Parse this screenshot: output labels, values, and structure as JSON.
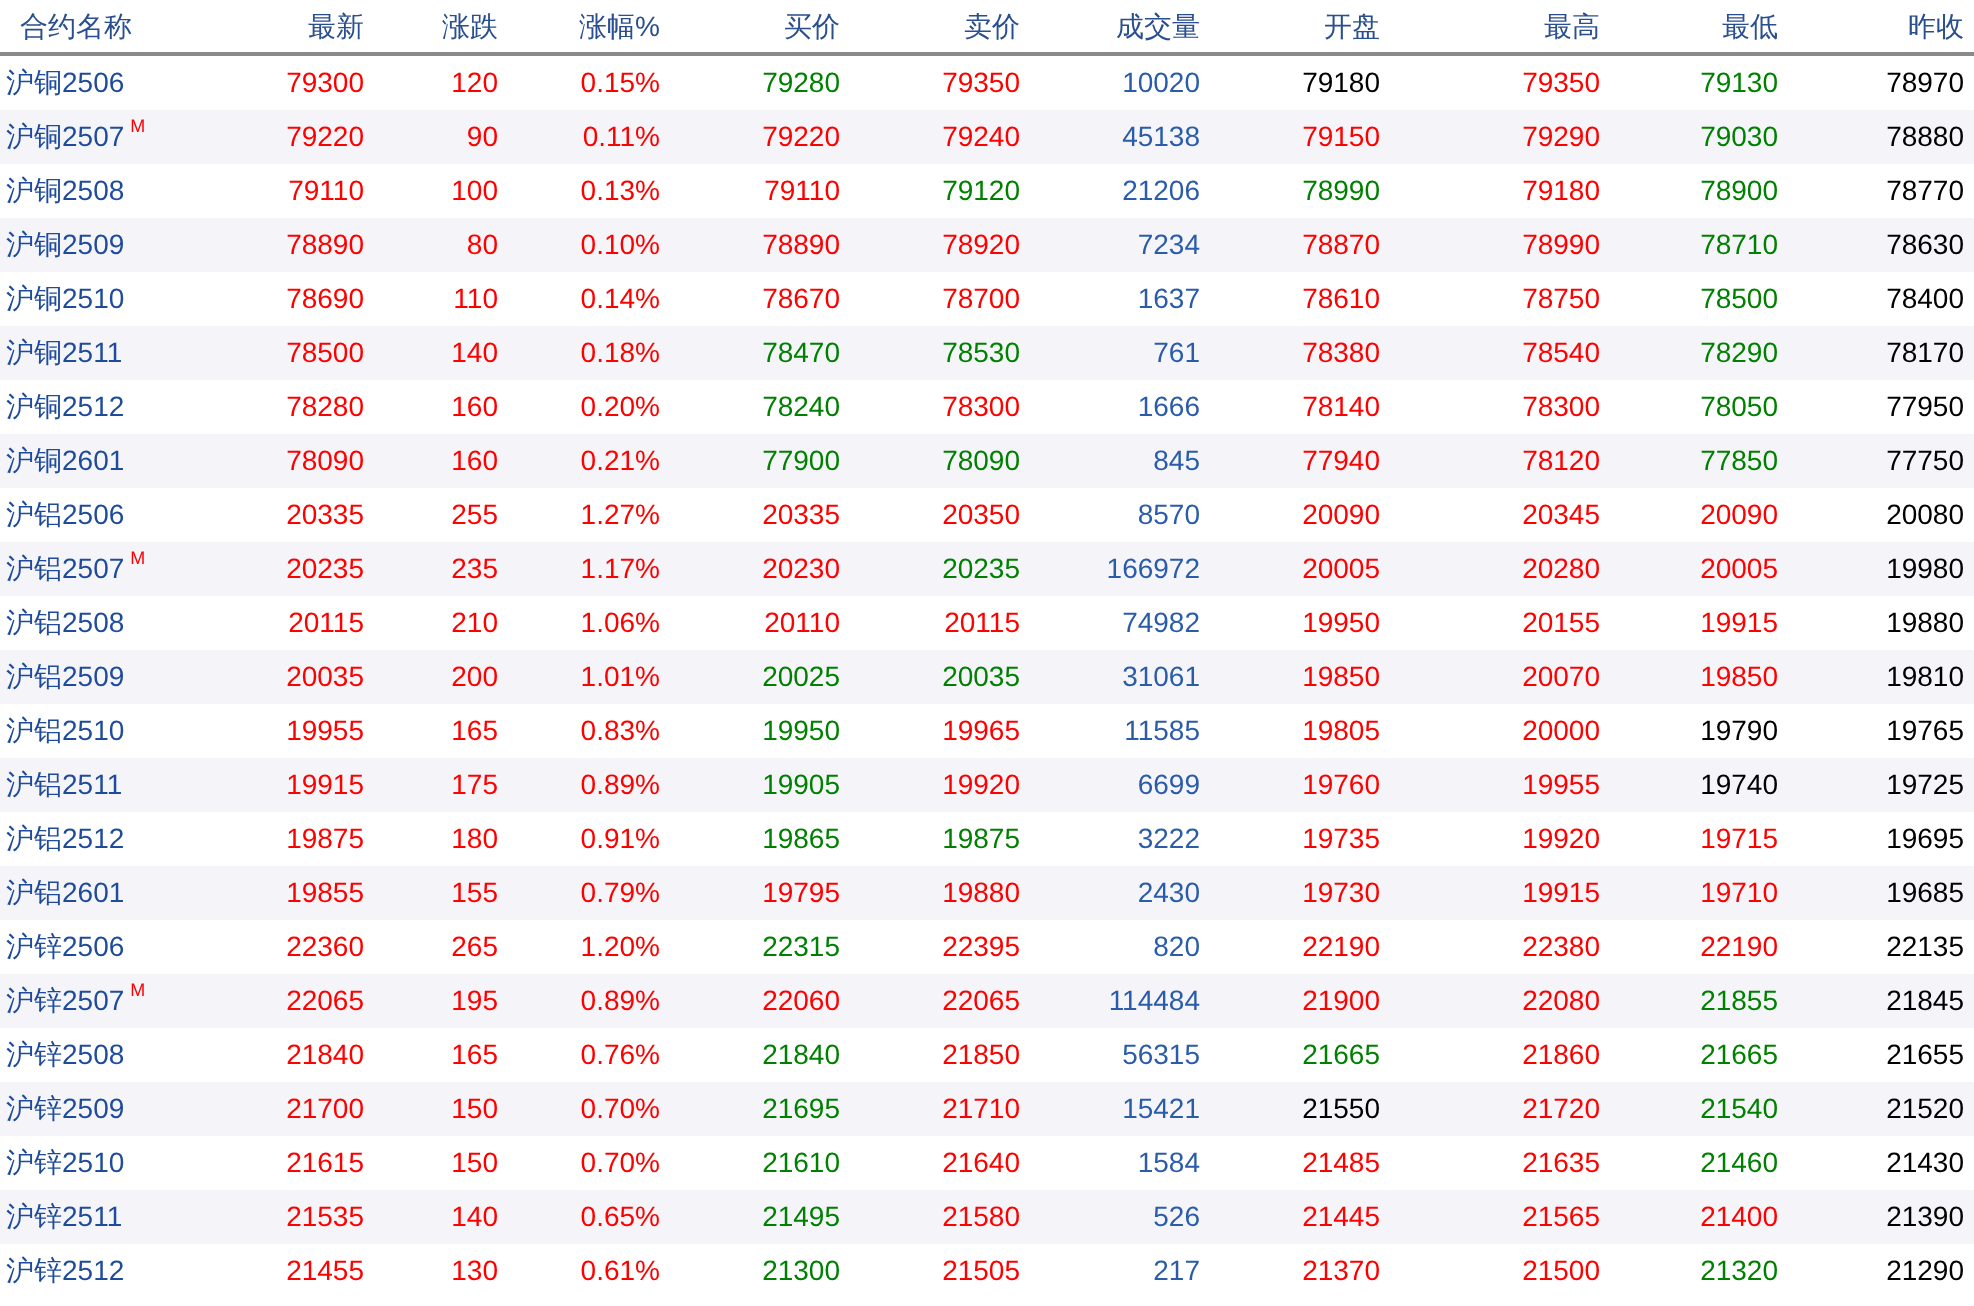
{
  "table": {
    "columns": [
      "合约名称",
      "最新",
      "涨跌",
      "涨幅%",
      "买价",
      "卖价",
      "成交量",
      "开盘",
      "最高",
      "最低",
      "昨收"
    ],
    "rows": [
      {
        "cells": [
          {
            "text": "沪铜2506",
            "color": "#1e4b9b"
          },
          {
            "text": "79300",
            "color": "#ff0000"
          },
          {
            "text": "120",
            "color": "#ff0000"
          },
          {
            "text": "0.15%",
            "color": "#ff0000"
          },
          {
            "text": "79280",
            "color": "#008000"
          },
          {
            "text": "79350",
            "color": "#ff0000"
          },
          {
            "text": "10020",
            "color": "#2a5caa"
          },
          {
            "text": "79180",
            "color": "#000000"
          },
          {
            "text": "79350",
            "color": "#ff0000"
          },
          {
            "text": "79130",
            "color": "#008000"
          },
          {
            "text": "78970",
            "color": "#000000"
          }
        ]
      },
      {
        "cells": [
          {
            "text": "沪铜2507",
            "color": "#1e4b9b",
            "badge": "M"
          },
          {
            "text": "79220",
            "color": "#ff0000"
          },
          {
            "text": "90",
            "color": "#ff0000"
          },
          {
            "text": "0.11%",
            "color": "#ff0000"
          },
          {
            "text": "79220",
            "color": "#ff0000"
          },
          {
            "text": "79240",
            "color": "#ff0000"
          },
          {
            "text": "45138",
            "color": "#2a5caa"
          },
          {
            "text": "79150",
            "color": "#ff0000"
          },
          {
            "text": "79290",
            "color": "#ff0000"
          },
          {
            "text": "79030",
            "color": "#008000"
          },
          {
            "text": "78880",
            "color": "#000000"
          }
        ]
      },
      {
        "cells": [
          {
            "text": "沪铜2508",
            "color": "#1e4b9b"
          },
          {
            "text": "79110",
            "color": "#ff0000"
          },
          {
            "text": "100",
            "color": "#ff0000"
          },
          {
            "text": "0.13%",
            "color": "#ff0000"
          },
          {
            "text": "79110",
            "color": "#ff0000"
          },
          {
            "text": "79120",
            "color": "#008000"
          },
          {
            "text": "21206",
            "color": "#2a5caa"
          },
          {
            "text": "78990",
            "color": "#008000"
          },
          {
            "text": "79180",
            "color": "#ff0000"
          },
          {
            "text": "78900",
            "color": "#008000"
          },
          {
            "text": "78770",
            "color": "#000000"
          }
        ]
      },
      {
        "cells": [
          {
            "text": "沪铜2509",
            "color": "#1e4b9b"
          },
          {
            "text": "78890",
            "color": "#ff0000"
          },
          {
            "text": "80",
            "color": "#ff0000"
          },
          {
            "text": "0.10%",
            "color": "#ff0000"
          },
          {
            "text": "78890",
            "color": "#ff0000"
          },
          {
            "text": "78920",
            "color": "#ff0000"
          },
          {
            "text": "7234",
            "color": "#2a5caa"
          },
          {
            "text": "78870",
            "color": "#ff0000"
          },
          {
            "text": "78990",
            "color": "#ff0000"
          },
          {
            "text": "78710",
            "color": "#008000"
          },
          {
            "text": "78630",
            "color": "#000000"
          }
        ]
      },
      {
        "cells": [
          {
            "text": "沪铜2510",
            "color": "#1e4b9b"
          },
          {
            "text": "78690",
            "color": "#ff0000"
          },
          {
            "text": "110",
            "color": "#ff0000"
          },
          {
            "text": "0.14%",
            "color": "#ff0000"
          },
          {
            "text": "78670",
            "color": "#ff0000"
          },
          {
            "text": "78700",
            "color": "#ff0000"
          },
          {
            "text": "1637",
            "color": "#2a5caa"
          },
          {
            "text": "78610",
            "color": "#ff0000"
          },
          {
            "text": "78750",
            "color": "#ff0000"
          },
          {
            "text": "78500",
            "color": "#008000"
          },
          {
            "text": "78400",
            "color": "#000000"
          }
        ]
      },
      {
        "cells": [
          {
            "text": "沪铜2511",
            "color": "#1e4b9b"
          },
          {
            "text": "78500",
            "color": "#ff0000"
          },
          {
            "text": "140",
            "color": "#ff0000"
          },
          {
            "text": "0.18%",
            "color": "#ff0000"
          },
          {
            "text": "78470",
            "color": "#008000"
          },
          {
            "text": "78530",
            "color": "#008000"
          },
          {
            "text": "761",
            "color": "#2a5caa"
          },
          {
            "text": "78380",
            "color": "#ff0000"
          },
          {
            "text": "78540",
            "color": "#ff0000"
          },
          {
            "text": "78290",
            "color": "#008000"
          },
          {
            "text": "78170",
            "color": "#000000"
          }
        ]
      },
      {
        "cells": [
          {
            "text": "沪铜2512",
            "color": "#1e4b9b"
          },
          {
            "text": "78280",
            "color": "#ff0000"
          },
          {
            "text": "160",
            "color": "#ff0000"
          },
          {
            "text": "0.20%",
            "color": "#ff0000"
          },
          {
            "text": "78240",
            "color": "#008000"
          },
          {
            "text": "78300",
            "color": "#ff0000"
          },
          {
            "text": "1666",
            "color": "#2a5caa"
          },
          {
            "text": "78140",
            "color": "#ff0000"
          },
          {
            "text": "78300",
            "color": "#ff0000"
          },
          {
            "text": "78050",
            "color": "#008000"
          },
          {
            "text": "77950",
            "color": "#000000"
          }
        ]
      },
      {
        "cells": [
          {
            "text": "沪铜2601",
            "color": "#1e4b9b"
          },
          {
            "text": "78090",
            "color": "#ff0000"
          },
          {
            "text": "160",
            "color": "#ff0000"
          },
          {
            "text": "0.21%",
            "color": "#ff0000"
          },
          {
            "text": "77900",
            "color": "#008000"
          },
          {
            "text": "78090",
            "color": "#008000"
          },
          {
            "text": "845",
            "color": "#2a5caa"
          },
          {
            "text": "77940",
            "color": "#ff0000"
          },
          {
            "text": "78120",
            "color": "#ff0000"
          },
          {
            "text": "77850",
            "color": "#008000"
          },
          {
            "text": "77750",
            "color": "#000000"
          }
        ]
      },
      {
        "cells": [
          {
            "text": "沪铝2506",
            "color": "#1e4b9b"
          },
          {
            "text": "20335",
            "color": "#ff0000"
          },
          {
            "text": "255",
            "color": "#ff0000"
          },
          {
            "text": "1.27%",
            "color": "#ff0000"
          },
          {
            "text": "20335",
            "color": "#ff0000"
          },
          {
            "text": "20350",
            "color": "#ff0000"
          },
          {
            "text": "8570",
            "color": "#2a5caa"
          },
          {
            "text": "20090",
            "color": "#ff0000"
          },
          {
            "text": "20345",
            "color": "#ff0000"
          },
          {
            "text": "20090",
            "color": "#ff0000"
          },
          {
            "text": "20080",
            "color": "#000000"
          }
        ]
      },
      {
        "cells": [
          {
            "text": "沪铝2507",
            "color": "#1e4b9b",
            "badge": "M"
          },
          {
            "text": "20235",
            "color": "#ff0000"
          },
          {
            "text": "235",
            "color": "#ff0000"
          },
          {
            "text": "1.17%",
            "color": "#ff0000"
          },
          {
            "text": "20230",
            "color": "#ff0000"
          },
          {
            "text": "20235",
            "color": "#008000"
          },
          {
            "text": "166972",
            "color": "#2a5caa"
          },
          {
            "text": "20005",
            "color": "#ff0000"
          },
          {
            "text": "20280",
            "color": "#ff0000"
          },
          {
            "text": "20005",
            "color": "#ff0000"
          },
          {
            "text": "19980",
            "color": "#000000"
          }
        ]
      },
      {
        "cells": [
          {
            "text": "沪铝2508",
            "color": "#1e4b9b"
          },
          {
            "text": "20115",
            "color": "#ff0000"
          },
          {
            "text": "210",
            "color": "#ff0000"
          },
          {
            "text": "1.06%",
            "color": "#ff0000"
          },
          {
            "text": "20110",
            "color": "#ff0000"
          },
          {
            "text": "20115",
            "color": "#ff0000"
          },
          {
            "text": "74982",
            "color": "#2a5caa"
          },
          {
            "text": "19950",
            "color": "#ff0000"
          },
          {
            "text": "20155",
            "color": "#ff0000"
          },
          {
            "text": "19915",
            "color": "#ff0000"
          },
          {
            "text": "19880",
            "color": "#000000"
          }
        ]
      },
      {
        "cells": [
          {
            "text": "沪铝2509",
            "color": "#1e4b9b"
          },
          {
            "text": "20035",
            "color": "#ff0000"
          },
          {
            "text": "200",
            "color": "#ff0000"
          },
          {
            "text": "1.01%",
            "color": "#ff0000"
          },
          {
            "text": "20025",
            "color": "#008000"
          },
          {
            "text": "20035",
            "color": "#008000"
          },
          {
            "text": "31061",
            "color": "#2a5caa"
          },
          {
            "text": "19850",
            "color": "#ff0000"
          },
          {
            "text": "20070",
            "color": "#ff0000"
          },
          {
            "text": "19850",
            "color": "#ff0000"
          },
          {
            "text": "19810",
            "color": "#000000"
          }
        ]
      },
      {
        "cells": [
          {
            "text": "沪铝2510",
            "color": "#1e4b9b"
          },
          {
            "text": "19955",
            "color": "#ff0000"
          },
          {
            "text": "165",
            "color": "#ff0000"
          },
          {
            "text": "0.83%",
            "color": "#ff0000"
          },
          {
            "text": "19950",
            "color": "#008000"
          },
          {
            "text": "19965",
            "color": "#ff0000"
          },
          {
            "text": "11585",
            "color": "#2a5caa"
          },
          {
            "text": "19805",
            "color": "#ff0000"
          },
          {
            "text": "20000",
            "color": "#ff0000"
          },
          {
            "text": "19790",
            "color": "#000000"
          },
          {
            "text": "19765",
            "color": "#000000"
          }
        ]
      },
      {
        "cells": [
          {
            "text": "沪铝2511",
            "color": "#1e4b9b"
          },
          {
            "text": "19915",
            "color": "#ff0000"
          },
          {
            "text": "175",
            "color": "#ff0000"
          },
          {
            "text": "0.89%",
            "color": "#ff0000"
          },
          {
            "text": "19905",
            "color": "#008000"
          },
          {
            "text": "19920",
            "color": "#ff0000"
          },
          {
            "text": "6699",
            "color": "#2a5caa"
          },
          {
            "text": "19760",
            "color": "#ff0000"
          },
          {
            "text": "19955",
            "color": "#ff0000"
          },
          {
            "text": "19740",
            "color": "#000000"
          },
          {
            "text": "19725",
            "color": "#000000"
          }
        ]
      },
      {
        "cells": [
          {
            "text": "沪铝2512",
            "color": "#1e4b9b"
          },
          {
            "text": "19875",
            "color": "#ff0000"
          },
          {
            "text": "180",
            "color": "#ff0000"
          },
          {
            "text": "0.91%",
            "color": "#ff0000"
          },
          {
            "text": "19865",
            "color": "#008000"
          },
          {
            "text": "19875",
            "color": "#008000"
          },
          {
            "text": "3222",
            "color": "#2a5caa"
          },
          {
            "text": "19735",
            "color": "#ff0000"
          },
          {
            "text": "19920",
            "color": "#ff0000"
          },
          {
            "text": "19715",
            "color": "#ff0000"
          },
          {
            "text": "19695",
            "color": "#000000"
          }
        ]
      },
      {
        "cells": [
          {
            "text": "沪铝2601",
            "color": "#1e4b9b"
          },
          {
            "text": "19855",
            "color": "#ff0000"
          },
          {
            "text": "155",
            "color": "#ff0000"
          },
          {
            "text": "0.79%",
            "color": "#ff0000"
          },
          {
            "text": "19795",
            "color": "#ff0000"
          },
          {
            "text": "19880",
            "color": "#ff0000"
          },
          {
            "text": "2430",
            "color": "#2a5caa"
          },
          {
            "text": "19730",
            "color": "#ff0000"
          },
          {
            "text": "19915",
            "color": "#ff0000"
          },
          {
            "text": "19710",
            "color": "#ff0000"
          },
          {
            "text": "19685",
            "color": "#000000"
          }
        ]
      },
      {
        "cells": [
          {
            "text": "沪锌2506",
            "color": "#1e4b9b"
          },
          {
            "text": "22360",
            "color": "#ff0000"
          },
          {
            "text": "265",
            "color": "#ff0000"
          },
          {
            "text": "1.20%",
            "color": "#ff0000"
          },
          {
            "text": "22315",
            "color": "#008000"
          },
          {
            "text": "22395",
            "color": "#ff0000"
          },
          {
            "text": "820",
            "color": "#2a5caa"
          },
          {
            "text": "22190",
            "color": "#ff0000"
          },
          {
            "text": "22380",
            "color": "#ff0000"
          },
          {
            "text": "22190",
            "color": "#ff0000"
          },
          {
            "text": "22135",
            "color": "#000000"
          }
        ]
      },
      {
        "cells": [
          {
            "text": "沪锌2507",
            "color": "#1e4b9b",
            "badge": "M"
          },
          {
            "text": "22065",
            "color": "#ff0000"
          },
          {
            "text": "195",
            "color": "#ff0000"
          },
          {
            "text": "0.89%",
            "color": "#ff0000"
          },
          {
            "text": "22060",
            "color": "#ff0000"
          },
          {
            "text": "22065",
            "color": "#ff0000"
          },
          {
            "text": "114484",
            "color": "#2a5caa"
          },
          {
            "text": "21900",
            "color": "#ff0000"
          },
          {
            "text": "22080",
            "color": "#ff0000"
          },
          {
            "text": "21855",
            "color": "#008000"
          },
          {
            "text": "21845",
            "color": "#000000"
          }
        ]
      },
      {
        "cells": [
          {
            "text": "沪锌2508",
            "color": "#1e4b9b"
          },
          {
            "text": "21840",
            "color": "#ff0000"
          },
          {
            "text": "165",
            "color": "#ff0000"
          },
          {
            "text": "0.76%",
            "color": "#ff0000"
          },
          {
            "text": "21840",
            "color": "#008000"
          },
          {
            "text": "21850",
            "color": "#ff0000"
          },
          {
            "text": "56315",
            "color": "#2a5caa"
          },
          {
            "text": "21665",
            "color": "#008000"
          },
          {
            "text": "21860",
            "color": "#ff0000"
          },
          {
            "text": "21665",
            "color": "#008000"
          },
          {
            "text": "21655",
            "color": "#000000"
          }
        ]
      },
      {
        "cells": [
          {
            "text": "沪锌2509",
            "color": "#1e4b9b"
          },
          {
            "text": "21700",
            "color": "#ff0000"
          },
          {
            "text": "150",
            "color": "#ff0000"
          },
          {
            "text": "0.70%",
            "color": "#ff0000"
          },
          {
            "text": "21695",
            "color": "#008000"
          },
          {
            "text": "21710",
            "color": "#ff0000"
          },
          {
            "text": "15421",
            "color": "#2a5caa"
          },
          {
            "text": "21550",
            "color": "#000000"
          },
          {
            "text": "21720",
            "color": "#ff0000"
          },
          {
            "text": "21540",
            "color": "#008000"
          },
          {
            "text": "21520",
            "color": "#000000"
          }
        ]
      },
      {
        "cells": [
          {
            "text": "沪锌2510",
            "color": "#1e4b9b"
          },
          {
            "text": "21615",
            "color": "#ff0000"
          },
          {
            "text": "150",
            "color": "#ff0000"
          },
          {
            "text": "0.70%",
            "color": "#ff0000"
          },
          {
            "text": "21610",
            "color": "#008000"
          },
          {
            "text": "21640",
            "color": "#ff0000"
          },
          {
            "text": "1584",
            "color": "#2a5caa"
          },
          {
            "text": "21485",
            "color": "#ff0000"
          },
          {
            "text": "21635",
            "color": "#ff0000"
          },
          {
            "text": "21460",
            "color": "#008000"
          },
          {
            "text": "21430",
            "color": "#000000"
          }
        ]
      },
      {
        "cells": [
          {
            "text": "沪锌2511",
            "color": "#1e4b9b"
          },
          {
            "text": "21535",
            "color": "#ff0000"
          },
          {
            "text": "140",
            "color": "#ff0000"
          },
          {
            "text": "0.65%",
            "color": "#ff0000"
          },
          {
            "text": "21495",
            "color": "#008000"
          },
          {
            "text": "21580",
            "color": "#ff0000"
          },
          {
            "text": "526",
            "color": "#2a5caa"
          },
          {
            "text": "21445",
            "color": "#ff0000"
          },
          {
            "text": "21565",
            "color": "#ff0000"
          },
          {
            "text": "21400",
            "color": "#ff0000"
          },
          {
            "text": "21390",
            "color": "#000000"
          }
        ]
      },
      {
        "cells": [
          {
            "text": "沪锌2512",
            "color": "#1e4b9b"
          },
          {
            "text": "21455",
            "color": "#ff0000"
          },
          {
            "text": "130",
            "color": "#ff0000"
          },
          {
            "text": "0.61%",
            "color": "#ff0000"
          },
          {
            "text": "21300",
            "color": "#008000"
          },
          {
            "text": "21505",
            "color": "#ff0000"
          },
          {
            "text": "217",
            "color": "#2a5caa"
          },
          {
            "text": "21370",
            "color": "#ff0000"
          },
          {
            "text": "21500",
            "color": "#ff0000"
          },
          {
            "text": "21320",
            "color": "#008000"
          },
          {
            "text": "21290",
            "color": "#000000"
          }
        ]
      }
    ]
  }
}
